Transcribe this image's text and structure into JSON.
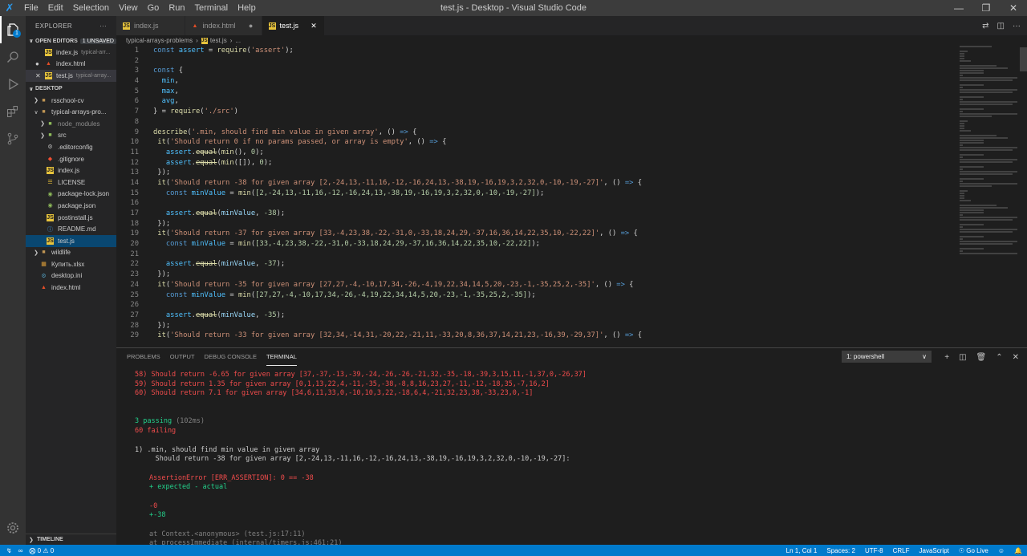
{
  "window": {
    "title": "test.js - Desktop - Visual Studio Code"
  },
  "menu": [
    "File",
    "Edit",
    "Selection",
    "View",
    "Go",
    "Run",
    "Terminal",
    "Help"
  ],
  "activity": {
    "explorer_badge": "1"
  },
  "explorer": {
    "header": "EXPLORER",
    "open_editors": {
      "label": "OPEN EDITORS",
      "unsaved": "1 UNSAVED",
      "items": [
        {
          "name": "index.js",
          "desc": "typical-arr..."
        },
        {
          "name": "index.html",
          "desc": ""
        },
        {
          "name": "test.js",
          "desc": "typical-array..."
        }
      ]
    },
    "folder": {
      "label": "DESKTOP",
      "items": [
        {
          "name": "rsschool-cv"
        },
        {
          "name": "typical-arrays-pro..."
        },
        {
          "name": "node_modules"
        },
        {
          "name": "src"
        },
        {
          "name": ".editorconfig"
        },
        {
          "name": ".gitignore"
        },
        {
          "name": "index.js"
        },
        {
          "name": "LICENSE"
        },
        {
          "name": "package-lock.json"
        },
        {
          "name": "package.json"
        },
        {
          "name": "postinstall.js"
        },
        {
          "name": "README.md"
        },
        {
          "name": "test.js"
        },
        {
          "name": "wildlife"
        },
        {
          "name": "Купить.xlsx"
        },
        {
          "name": "desktop.ini"
        },
        {
          "name": "index.html"
        }
      ]
    },
    "timeline": "TIMELINE"
  },
  "tabs": [
    {
      "label": "index.js"
    },
    {
      "label": "index.html"
    },
    {
      "label": "test.js"
    }
  ],
  "breadcrumb": {
    "folder": "typical-arrays-problems",
    "file": "test.js",
    "more": "..."
  },
  "editor": {
    "line_numbers": [
      "1",
      "2",
      "3",
      "4",
      "5",
      "6",
      "7",
      "8",
      "9",
      "10",
      "11",
      "12",
      "13",
      "14",
      "15",
      "16",
      "17",
      "18",
      "19",
      "20",
      "21",
      "22",
      "23",
      "24",
      "25",
      "26",
      "27",
      "28",
      "29"
    ],
    "strings": {
      "l1": "'assert'",
      "l7": "'./src'",
      "l9": "'.min, should find min value in given array'",
      "l10": "'Should return 0 if no params passed, or array is empty'",
      "l15": "'Should return -38 for given array [2,-24,13,-11,16,-12,-16,24,13,-38,19,-16,19,3,2,32,0,-10,-19,-27]'",
      "l16": "[2,-24,13,-11,16,-12,-16,24,13,-38,19,-16,19,3,2,32,0,-10,-19,-27]",
      "l17": "-38",
      "l19": "'Should return -37 for given array [33,-4,23,38,-22,-31,0,-33,18,24,29,-37,16,36,14,22,35,10,-22,22]'",
      "l20": "[33,-4,23,38,-22,-31,0,-33,18,24,29,-37,16,36,14,22,35,10,-22,22]",
      "l22": "-37",
      "l24": "'Should return -35 for given array [27,27,-4,-10,17,34,-26,-4,19,22,34,14,5,20,-23,-1,-35,25,2,-35]'",
      "l25": "[27,27,-4,-10,17,34,-26,-4,19,22,34,14,5,20,-23,-1,-35,25,2,-35]",
      "l27": "-35",
      "l29": "'Should return -33 for given array [32,34,-14,31,-20,22,-21,11,-33,20,8,36,37,14,21,23,-16,39,-29,37]'"
    }
  },
  "panel": {
    "tabs": [
      "PROBLEMS",
      "OUTPUT",
      "DEBUG CONSOLE",
      "TERMINAL"
    ],
    "terminal_select": "1: powershell",
    "lines": {
      "t1": "58) Should return -6.65 for given array [37,-37,-13,-39,-24,-26,-26,-21,32,-35,-18,-39,3,15,11,-1,37,0,-26,37]",
      "t2": "59) Should return 1.35 for given array [0,1,13,22,4,-11,-35,-38,-8,8,16,23,27,-11,-12,-18,35,-7,16,2]",
      "t3": "60) Should return 7.1 for given array [34,6,11,33,0,-10,10,3,22,-18,6,4,-21,32,23,38,-33,23,0,-1]",
      "passing": "3 passing",
      "passing_time": "(102ms)",
      "failing": "60 failing",
      "f1": "1) .min, should find min value in given array",
      "f2": "     Should return -38 for given array [2,-24,13,-11,16,-12,-16,24,13,-38,19,-16,19,3,2,32,0,-10,-19,-27]:",
      "err": "AssertionError [ERR_ASSERTION]: 0 == -38",
      "exp": "+ expected - actual",
      "minus": "-0",
      "plus": "+-38",
      "st1": "at Context.<anonymous> (test.js:17:11)",
      "st2": "at processImmediate (internal/timers.js:461:21)"
    }
  },
  "status": {
    "errors": "0",
    "warnings": "0",
    "position": "Ln 1, Col 1",
    "spaces": "Spaces: 2",
    "encoding": "UTF-8",
    "eol": "CRLF",
    "language": "JavaScript",
    "golive": "Go Live"
  }
}
